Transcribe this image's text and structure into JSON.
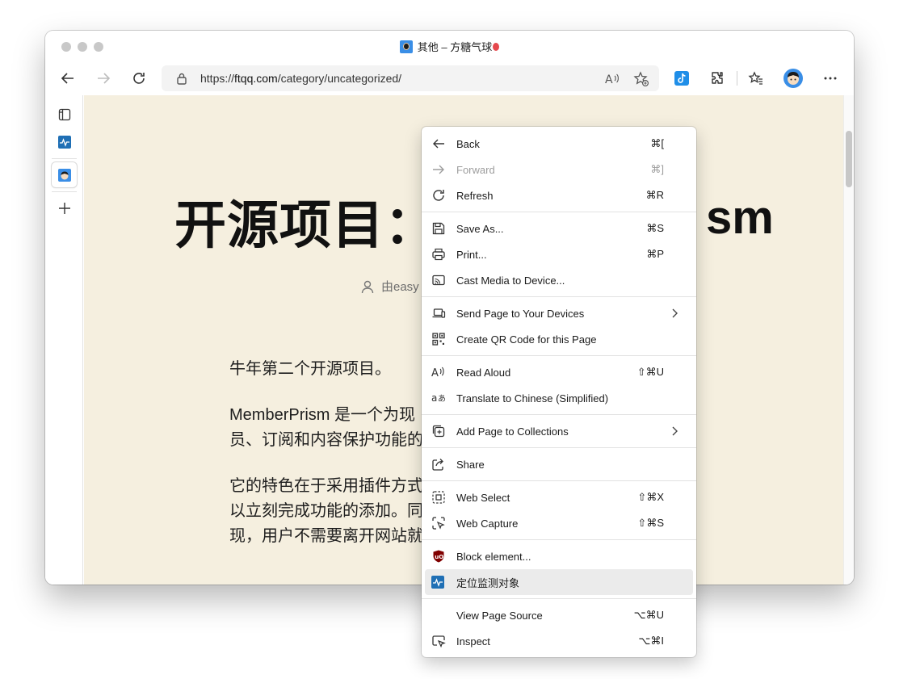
{
  "window": {
    "title": "其他 – 方糖气球"
  },
  "toolbar": {
    "url_prefix": "https://",
    "url_host": "ftqq.com",
    "url_path": "/category/uncategorized/"
  },
  "page": {
    "title": "开源项目：",
    "title_tail": "sm",
    "meta_author": "由easy",
    "paragraphs": [
      "牛年第二个开源项目。",
      "MemberPrism 是一个为现",
      "员、订阅和内容保护功能的",
      "它的特色在于采用插件方式",
      "以立刻完成功能的添加。同",
      "现，用户不需要离开网站就"
    ]
  },
  "menu": {
    "items": [
      {
        "label": "Back",
        "shortcut": "⌘[",
        "icon": "arrow-left-icon"
      },
      {
        "label": "Forward",
        "shortcut": "⌘]",
        "icon": "arrow-right-icon",
        "disabled": true
      },
      {
        "label": "Refresh",
        "shortcut": "⌘R",
        "icon": "refresh-icon"
      },
      {
        "label": "Save As...",
        "shortcut": "⌘S",
        "icon": "save-icon"
      },
      {
        "label": "Print...",
        "shortcut": "⌘P",
        "icon": "printer-icon"
      },
      {
        "label": "Cast Media to Device...",
        "shortcut": "",
        "icon": "cast-icon"
      },
      {
        "label": "Send Page to Your Devices",
        "shortcut": "",
        "icon": "devices-icon",
        "submenu": true
      },
      {
        "label": "Create QR Code for this Page",
        "shortcut": "",
        "icon": "qr-code-icon"
      },
      {
        "label": "Read Aloud",
        "shortcut": "⇧⌘U",
        "icon": "read-aloud-icon"
      },
      {
        "label": "Translate to Chinese (Simplified)",
        "shortcut": "",
        "icon": "translate-icon"
      },
      {
        "label": "Add Page to Collections",
        "shortcut": "",
        "icon": "collections-icon",
        "submenu": true
      },
      {
        "label": "Share",
        "shortcut": "",
        "icon": "share-icon"
      },
      {
        "label": "Web Select",
        "shortcut": "⇧⌘X",
        "icon": "web-select-icon"
      },
      {
        "label": "Web Capture",
        "shortcut": "⇧⌘S",
        "icon": "web-capture-icon"
      },
      {
        "label": "Block element...",
        "shortcut": "",
        "icon": "ublock-icon"
      },
      {
        "label": "定位监测对象",
        "shortcut": "",
        "icon": "monitor-pulse-icon",
        "highlighted": true
      },
      {
        "label": "View Page Source",
        "shortcut": "⌥⌘U",
        "icon": ""
      },
      {
        "label": "Inspect",
        "shortcut": "⌥⌘I",
        "icon": "inspect-icon"
      }
    ]
  },
  "colors": {
    "page_background": "#f5efdf",
    "accent": "#1f6fb5",
    "ublock_red": "#800000"
  }
}
